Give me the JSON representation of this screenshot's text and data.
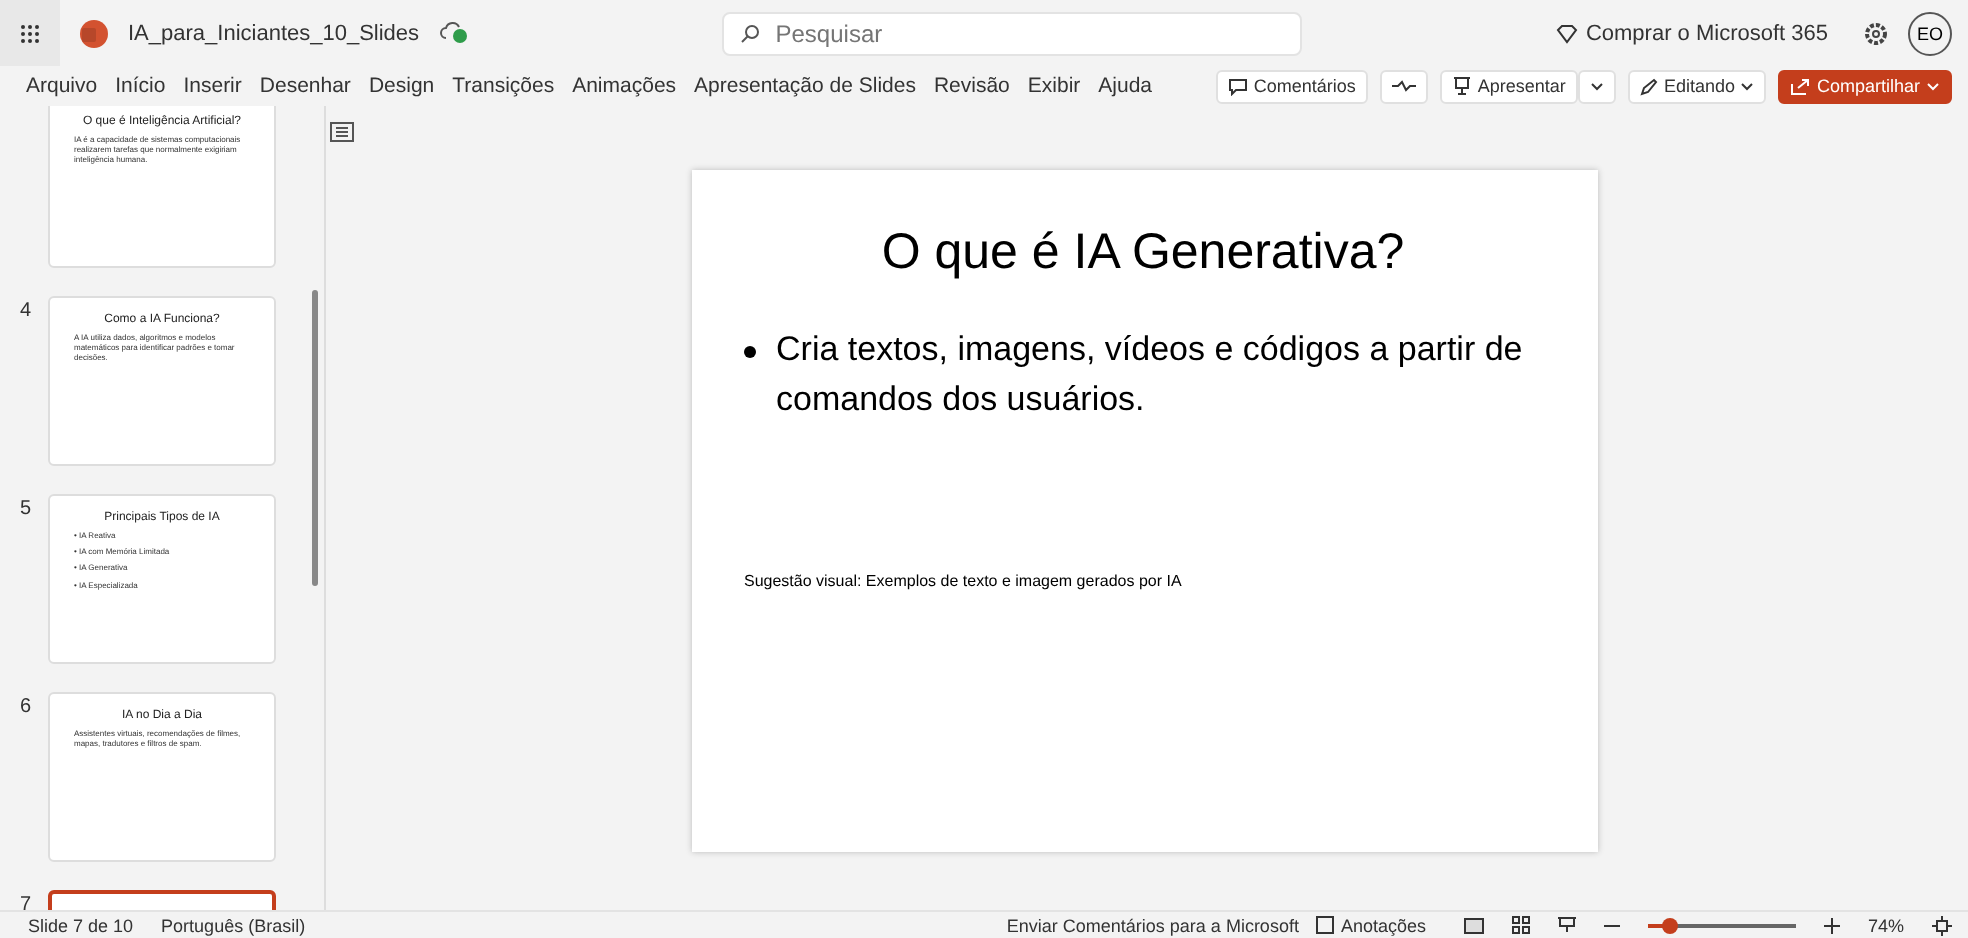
{
  "app": {
    "file_name": "IA_para_Iniciantes_10_Slides",
    "search_placeholder": "Pesquisar",
    "buy": "Comprar o Microsoft 365",
    "avatar": "EO"
  },
  "menu": [
    {
      "label": "Arquivo",
      "selected": false
    },
    {
      "label": "Início",
      "selected": false
    },
    {
      "label": "Inserir",
      "selected": false
    },
    {
      "label": "Desenhar",
      "selected": false
    },
    {
      "label": "Design",
      "selected": false
    },
    {
      "label": "Transições",
      "selected": false
    },
    {
      "label": "Animações",
      "selected": false
    },
    {
      "label": "Apresentação de Slides",
      "selected": false
    },
    {
      "label": "Revisão",
      "selected": false
    },
    {
      "label": "Exibir",
      "selected": false
    },
    {
      "label": "Ajuda",
      "selected": false
    }
  ],
  "actions": {
    "comments": "Comentários",
    "present": "Apresentar",
    "editing": "Editando",
    "share": "Compartilhar"
  },
  "thumbnails": [
    {
      "title": "O que é Inteligência Artificial?",
      "bullets": [
        "IA é a capacidade de sistemas computacionais realizarem tarefas que normalmente exigiriam inteligência humana."
      ],
      "selected": false
    },
    {
      "number": "4",
      "title": "Como a IA Funciona?",
      "bullets": [
        "A IA utiliza dados, algoritmos e modelos matemáticos para identificar padrões e tomar decisões."
      ],
      "selected": false
    },
    {
      "number": "5",
      "title": "Principais Tipos de IA",
      "bullets": [
        "• IA Reativa",
        "• IA com Memória Limitada",
        "• IA Generativa",
        "• IA Especializada"
      ],
      "selected": false
    },
    {
      "number": "6",
      "title": "IA no Dia a Dia",
      "bullets": [
        "Assistentes virtuais, recomendações de filmes, mapas, tradutores e filtros de spam."
      ],
      "selected": false
    },
    {
      "number": "7",
      "selected": true
    }
  ],
  "slide": {
    "title": "O que é IA Generativa?",
    "bullets": [
      "Cria textos, imagens, vídeos e códigos a partir de comandos dos usuários."
    ],
    "note": "Sugestão visual: Exemplos de texto e imagem gerados por IA"
  },
  "status": {
    "slide": "Slide 7 de 10",
    "language": "Português (Brasil)",
    "feedback": "Enviar Comentários para a Microsoft",
    "notes": "Anotações",
    "zoom": "74%",
    "zoom_slider": {
      "level": 0.15
    }
  }
}
